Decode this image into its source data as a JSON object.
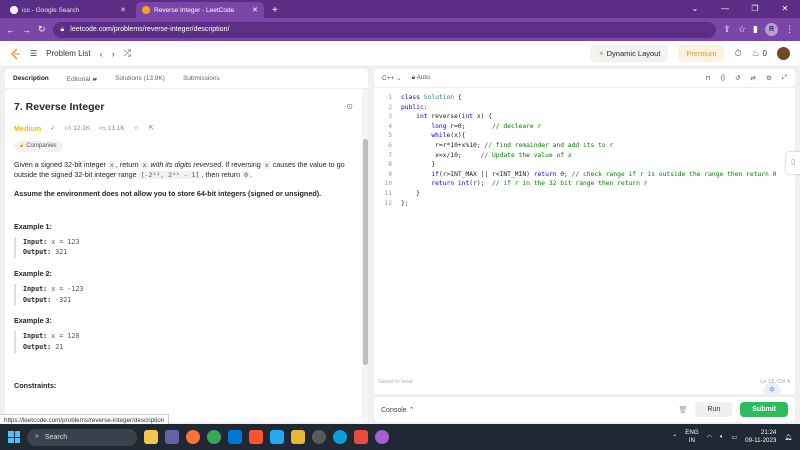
{
  "browser": {
    "tabs": [
      {
        "title": "icc - Google Search",
        "active": false
      },
      {
        "title": "Reverse Integer - LeetCode",
        "active": true
      }
    ],
    "url": "leetcode.com/problems/reverse-integer/description/",
    "profile_initial": "R"
  },
  "nav": {
    "problem_list": "Problem List",
    "dynamic_layout": "Dynamic Layout",
    "premium": "Premium",
    "streak": "0"
  },
  "panel_tabs": {
    "description": "Description",
    "editorial": "Editorial",
    "solutions": "Solutions (13.9K)",
    "submissions": "Submissions"
  },
  "problem": {
    "title": "7. Reverse Integer",
    "difficulty": "Medium",
    "likes": "12.1K",
    "dislikes": "13.1K",
    "companies": "Companies",
    "desc_1": "Given a signed 32-bit integer ",
    "desc_x1": "x",
    "desc_2": ", return ",
    "desc_x2": "x",
    "desc_3": " with its digits reversed",
    "desc_4": ". If reversing ",
    "desc_x3": "x",
    "desc_5": " causes the value to go outside the signed 32-bit integer range ",
    "desc_range": "[-2³¹, 2³¹ - 1]",
    "desc_6": ", then return ",
    "desc_zero": "0",
    "desc_7": ".",
    "assume": "Assume the environment does not allow you to store 64-bit integers (signed or unsigned).",
    "examples": [
      {
        "heading": "Example 1:",
        "input_label": "Input:",
        "input": "x = 123",
        "output_label": "Output:",
        "output": "321"
      },
      {
        "heading": "Example 2:",
        "input_label": "Input:",
        "input": "x = -123",
        "output_label": "Output:",
        "output": "-321"
      },
      {
        "heading": "Example 3:",
        "input_label": "Input:",
        "input": "x = 120",
        "output_label": "Output:",
        "output": "21"
      }
    ],
    "constraints": "Constraints:"
  },
  "editor": {
    "language": "C++",
    "mode": "Auto",
    "lines": [
      {
        "n": "1",
        "code": "class Solution {"
      },
      {
        "n": "2",
        "code": "public:"
      },
      {
        "n": "3",
        "code": "    int reverse(int x) {"
      },
      {
        "n": "4",
        "code": "        long r=0;       // decleare r"
      },
      {
        "n": "5",
        "code": "        while(x){"
      },
      {
        "n": "6",
        "code": "         r=r*10+x%10; // find remainder and add its to r"
      },
      {
        "n": "7",
        "code": "         x=x/10;     // Update the value of x"
      },
      {
        "n": "8",
        "code": "        }"
      },
      {
        "n": "9",
        "code": "        if(r>INT_MAX || r<INT_MIN) return 0; // check range if r is outside the range then return 0"
      },
      {
        "n": "10",
        "code": "        return int(r);  // if r in the 32 bit range then return r"
      },
      {
        "n": "11",
        "code": "    }"
      },
      {
        "n": "12",
        "code": "};"
      }
    ],
    "saved": "Saved to local",
    "cursor": "Ln 12, Col 4"
  },
  "console": {
    "label": "Console",
    "run": "Run",
    "submit": "Submit"
  },
  "status_url": "https://leetcode.com/problems/reverse-integer/description",
  "taskbar": {
    "search": "Search",
    "lang_line1": "ENG",
    "lang_line2": "IN",
    "time": "21:24",
    "date": "09-11-2023"
  },
  "colors": {
    "browser_frame": "#7a47a8",
    "medium": "#ffb800",
    "submit": "#2cbb5d",
    "premium": "#e59b2b"
  }
}
